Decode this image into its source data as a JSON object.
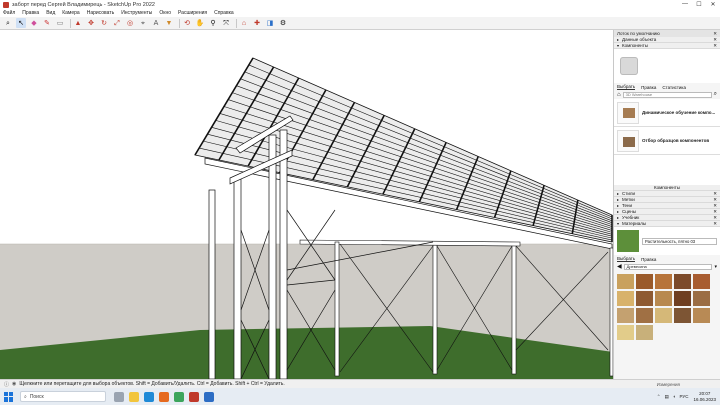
{
  "window": {
    "title": "заборт перед Сергей Владимирець - SketchUp Pro 2022",
    "minimize": "—",
    "maximize": "☐",
    "close": "✕"
  },
  "menu": [
    "Файл",
    "Правка",
    "Вид",
    "Камера",
    "Нарисовать",
    "Инструменты",
    "Окно",
    "Расширения",
    "Справка"
  ],
  "toolbar": {
    "icons": [
      "search-icon",
      "select-arrow-icon",
      "eraser-icon",
      "pencil-icon",
      "rectangle-icon",
      "circle-icon",
      "push-pull-icon",
      "move-icon",
      "rotate-icon",
      "scale-icon",
      "offset-icon",
      "tape-icon",
      "text-icon",
      "paint-bucket-icon",
      "orbit-icon",
      "pan-icon",
      "zoom-icon",
      "zoom-extents-icon",
      "warehouse-icon",
      "extension-icon",
      "layout-icon",
      "send-icon"
    ]
  },
  "tray": {
    "title": "Лоток по умолчанию",
    "entity_info": "Данные объекта",
    "components_header": "Компоненты",
    "tabs": [
      "Выбрать",
      "Правка",
      "Статистика"
    ],
    "search_placeholder": "3D Warehouse",
    "components": [
      {
        "label": "Динамическое обучение компо..."
      },
      {
        "label": "Отбор образцов компонентов"
      }
    ],
    "components_footer": "Компоненты",
    "panels": [
      "Стили",
      "Метки",
      "Тени",
      "Сцены",
      "Учебник",
      "Материалы"
    ],
    "material_name": "Растительность, пятно 03",
    "material_tabs": [
      "Выбрать",
      "Правка"
    ],
    "material_category": "Древесина",
    "swatch_colors": [
      "#c9a15e",
      "#9a5a2a",
      "#b7743a",
      "#7c4a2a",
      "#a85c30",
      "#d8b26b",
      "#8e5a32",
      "#b8894f",
      "#6f3f22",
      "#9b6d44",
      "#c4a170",
      "#a07044",
      "#d5b878",
      "#7d5534",
      "#b88a55",
      "#e2cc8a",
      "#c8b07a"
    ]
  },
  "status": {
    "text": "Щелкните или перетащите для выбора объектов. Shift = Добавить/Удалить. Ctrl = Добавить. Shift + Ctrl = Удалить.",
    "measure": "Измерения"
  },
  "taskbar": {
    "search": "Поиск",
    "lang": "РУС",
    "time": "20:07",
    "date": "16.06.2023"
  },
  "colors": {
    "sky": "#ffffff",
    "ground": "#cfccc7",
    "grass": "#3e6d2c",
    "steel": "#f4f4f4",
    "edge": "#111111",
    "accent": "#1a73d9"
  }
}
